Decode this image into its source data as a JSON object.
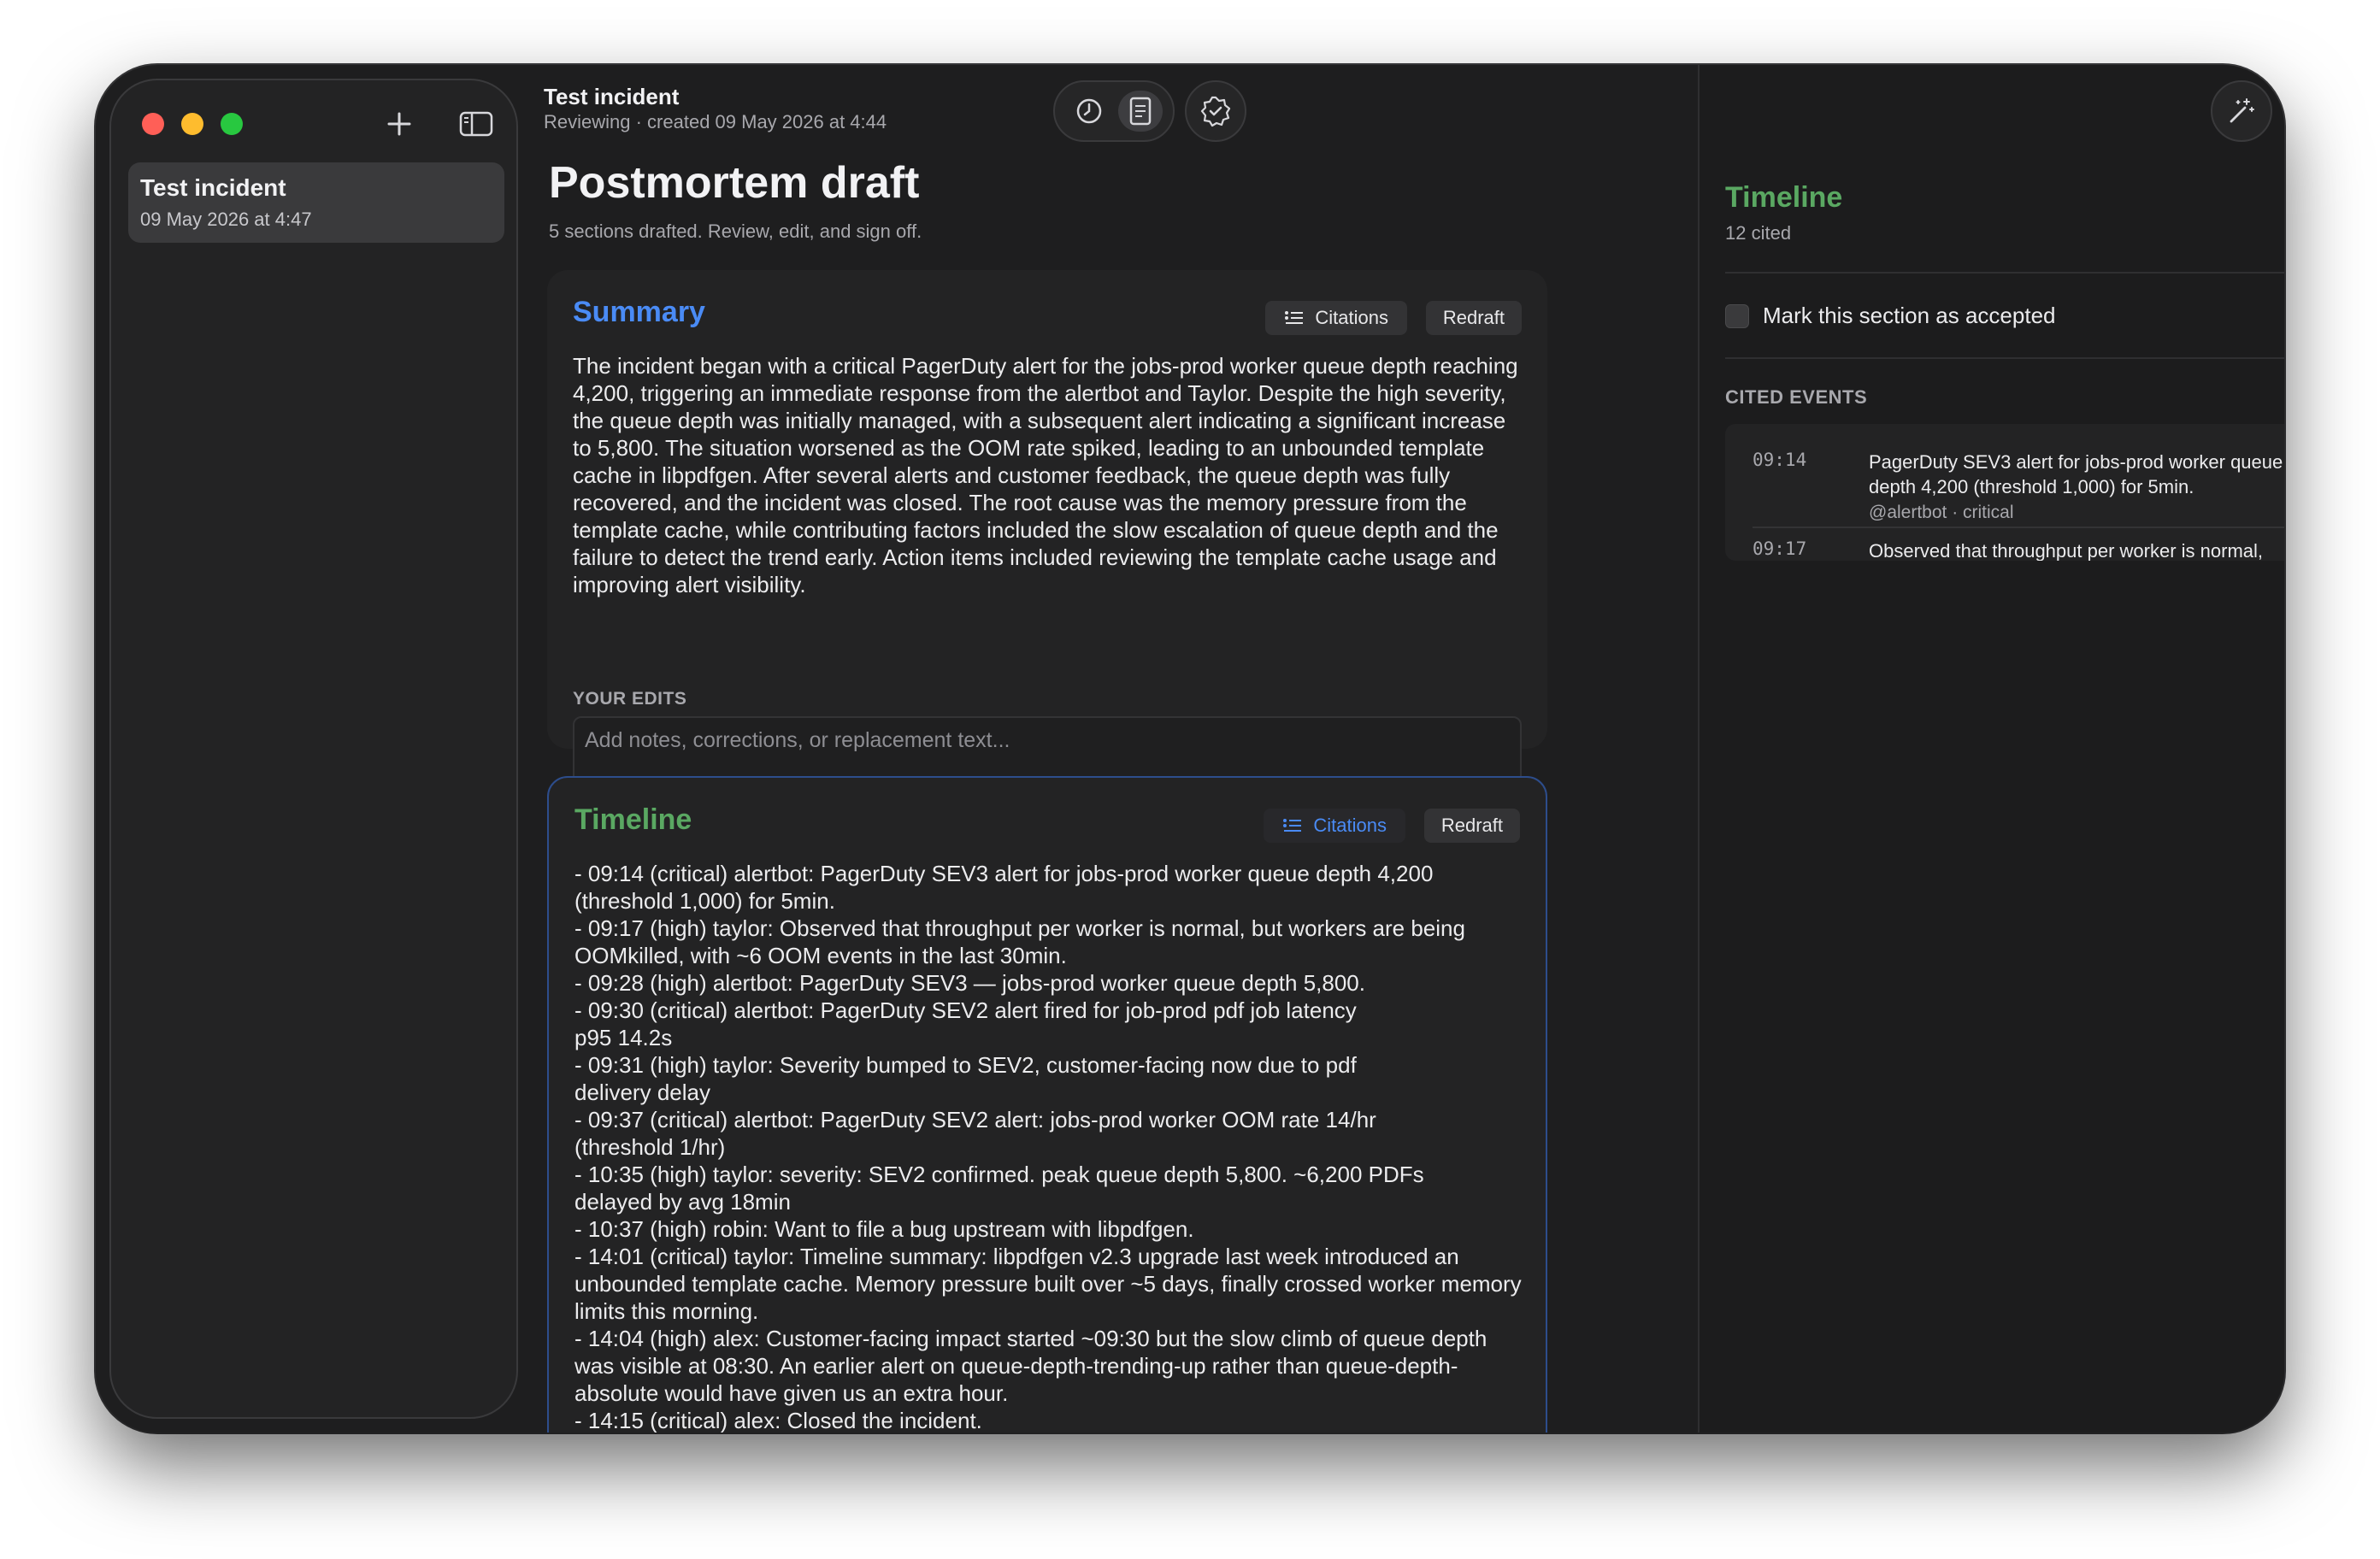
{
  "sidebar": {
    "incidents": [
      {
        "title": "Test incident",
        "date": "09 May 2026 at 4:47"
      }
    ]
  },
  "header": {
    "title": "Test incident",
    "subtitle": "Reviewing · created 09 May 2026 at 4:44"
  },
  "page": {
    "title": "Postmortem draft",
    "subtitle": "5 sections drafted. Review, edit, and sign off."
  },
  "sections": {
    "summary": {
      "title": "Summary",
      "citations_label": "Citations",
      "redraft_label": "Redraft",
      "body": "The incident began with a critical PagerDuty alert for the jobs-prod worker queue depth reaching 4,200, triggering an immediate response from the alertbot and Taylor. Despite the high severity, the queue depth was initially managed, with a subsequent alert indicating a significant increase to 5,800. The situation worsened as the OOM rate spiked, leading to an unbounded template cache in libpdfgen. After several alerts and customer feedback, the queue depth was fully recovered, and the incident was closed. The root cause was the memory pressure from the template cache, while contributing factors included the slow escalation of queue depth and the failure to detect the trend early. Action items included reviewing the template cache usage and improving alert visibility.",
      "edits_label": "YOUR EDITS",
      "edits_placeholder": "Add notes, corrections, or replacement text..."
    },
    "timeline": {
      "title": "Timeline",
      "citations_label": "Citations",
      "redraft_label": "Redraft",
      "body": "- 09:14 (critical) alertbot: PagerDuty SEV3 alert for jobs-prod worker queue depth 4,200 (threshold 1,000) for 5min.\n- 09:17 (high) taylor: Observed that throughput per worker is normal, but workers are being OOMkilled, with ~6 OOM events in the last 30min.\n- 09:28 (high) alertbot: PagerDuty SEV3 — jobs-prod worker queue depth 5,800.\n- 09:30 (critical) alertbot: PagerDuty SEV2 alert fired for job-prod pdf job latency\np95 14.2s\n- 09:31 (high) taylor: Severity bumped to SEV2, customer-facing now due to pdf\ndelivery delay\n- 09:37 (critical) alertbot: PagerDuty SEV2 alert: jobs-prod worker OOM rate 14/hr\n(threshold 1/hr)\n- 10:35 (high) taylor: severity: SEV2 confirmed. peak queue depth 5,800. ~6,200 PDFs\ndelayed by avg 18min\n- 10:37 (high) robin: Want to file a bug upstream with libpdfgen.\n- 14:01 (critical) taylor: Timeline summary: libpdfgen v2.3 upgrade last week introduced an unbounded template cache. Memory pressure built over ~5 days, finally crossed worker memory limits this morning.\n- 14:04 (high) alex: Customer-facing impact started ~09:30 but the slow climb of queue depth was visible at 08:30. An earlier alert on queue-depth-trending-up rather than queue-depth-absolute would have given us an extra hour.\n- 14:15 (critical) alex: Closed the incident."
    }
  },
  "right_panel": {
    "title": "Timeline",
    "cited_count": "12 cited",
    "accept_label": "Mark this section as accepted",
    "accepted": false,
    "cited_events_label": "CITED EVENTS",
    "events": [
      {
        "time": "09:14",
        "text": "PagerDuty SEV3 alert for jobs-prod worker queue depth 4,200 (threshold 1,000) for 5min.",
        "meta": "@alertbot · critical"
      },
      {
        "time": "09:17",
        "text": "Observed that throughput per worker is normal,",
        "meta": ""
      }
    ]
  },
  "colors": {
    "summary_accent": "#4a8bf5",
    "timeline_accent": "#5aa862",
    "window_bg": "#1e1e1f"
  },
  "icons": {
    "sidebar_add": "plus-icon",
    "sidebar_toggle": "sidebar-icon",
    "history": "clock-icon",
    "draft": "document-icon",
    "verify": "checkmark-seal-icon",
    "magic": "magic-wand-icon",
    "share": "share-icon"
  }
}
